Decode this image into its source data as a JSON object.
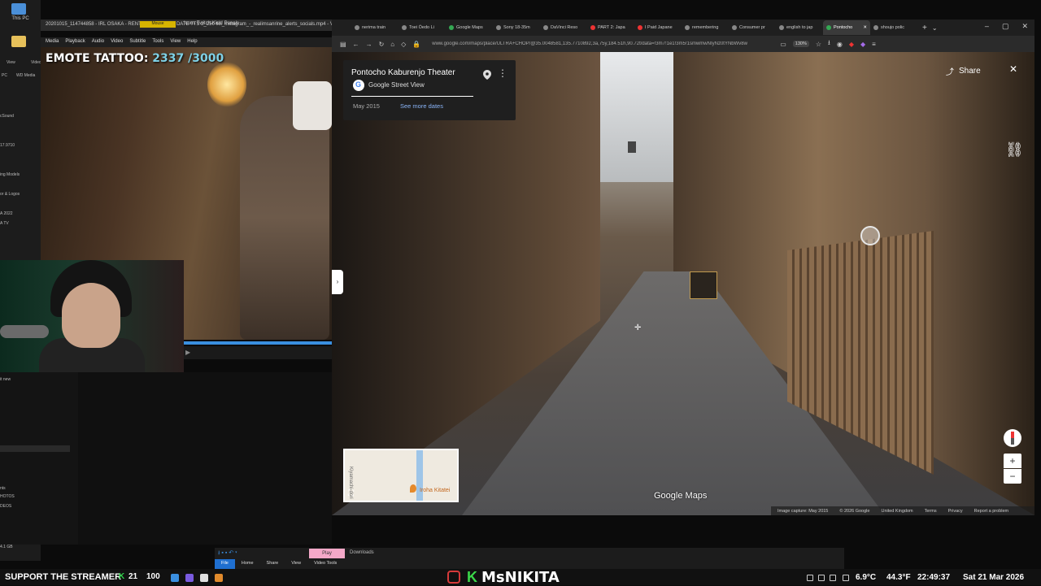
{
  "desktop": {
    "this_pc": "This PC",
    "strip_items": [
      "View",
      "Video",
      "PC",
      "WD Media",
      "cSound",
      "17.9710",
      "ing Models",
      "or & Logos",
      "A 2022",
      "A TV",
      "it new",
      "nts",
      "HOTOS",
      "DEOS",
      "4.1 GB"
    ]
  },
  "vlc": {
    "title": "20201015_114744858 - IRL OSAKA - RENT A BOYFRIEND DATE TTS 2_250 Ikli_Instagram_-_realimsanrine_alerts_socials.mp4 - VLC",
    "panel_title": "Icons Twitch-Kick! Panels",
    "menu": [
      "Media",
      "Playback",
      "Audio",
      "Video",
      "Subtitle",
      "Tools",
      "View",
      "Help"
    ],
    "emote_label": "EMOTE TATTOO:",
    "emote_count": "2337 /3000"
  },
  "browser": {
    "tabs": [
      {
        "label": "nerima train"
      },
      {
        "label": "Toei Ōedo Li"
      },
      {
        "label": "Google Maps"
      },
      {
        "label": "Sony 18-35m"
      },
      {
        "label": "DaVinci Reso"
      },
      {
        "label": "PART 2: Japa"
      },
      {
        "label": "I Paid Japane"
      },
      {
        "label": "remembering"
      },
      {
        "label": "Consumer pr"
      },
      {
        "label": "english to jap"
      },
      {
        "label": "Pontocho",
        "active": true
      },
      {
        "label": "shoujo polic"
      }
    ],
    "url": "www.google.com/maps/place/ULTRA+CHOP/@35.0048581,135.7710892,3a,75y,184.51h,90.72t/data=!3m7!1e1!3m5!1smwmwNIyNz0tYNbWv8w",
    "zoom": "130%"
  },
  "streetview": {
    "place_title": "Pontocho Kaburenjo Theater",
    "source": "Google Street View",
    "capture_date": "May 2015",
    "see_more": "See more dates",
    "share_label": "Share",
    "watermark": "Google Maps",
    "footer": [
      "Image capture: May 2015",
      "© 2026 Google",
      "United Kingdom",
      "Terms",
      "Privacy",
      "Report a problem"
    ],
    "minimap": {
      "street_label": "Kiyamachi-dori",
      "place_label": "Iroha Kitatei"
    }
  },
  "explorer": {
    "tabs": [
      "File",
      "Home",
      "Share",
      "View",
      "Video Tools"
    ],
    "play_label": "Play",
    "downloads_label": "Downloads"
  },
  "taskbar": {
    "support_text": "SUPPORT THE STREAMER",
    "k_badge": "K",
    "k_count": "21",
    "k_total": "100",
    "channel_name": "MsNIKITA",
    "weather": "6.9°C",
    "humidity": "44.3°F",
    "clock": "22:49:37",
    "date": "Sat 21 Mar 2026"
  },
  "colors": {
    "accent_blue": "#1f6fd0",
    "kick_green": "#3bd84a",
    "link_blue": "#8ab4f8"
  }
}
